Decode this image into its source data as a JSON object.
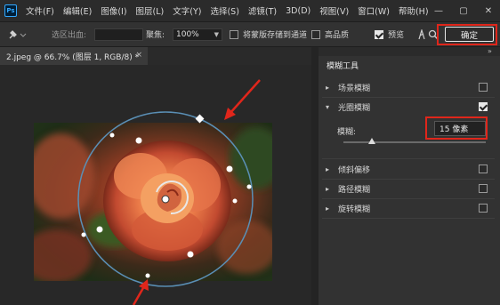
{
  "app": {
    "logo": "Ps"
  },
  "menu": [
    "文件(F)",
    "编辑(E)",
    "图像(I)",
    "图层(L)",
    "文字(Y)",
    "选择(S)",
    "滤镜(T)",
    "3D(D)",
    "视图(V)",
    "窗口(W)",
    "帮助(H)"
  ],
  "window_controls": {
    "minimize": "—",
    "restore": "▢",
    "close": "✕"
  },
  "options": {
    "pin_icon": "pin-icon",
    "selection_label": "选区出血:",
    "focus_label": "聚焦:",
    "focus_value": "100%",
    "save_mask_label": "将蒙版存储到通道",
    "save_mask_checked": false,
    "high_quality_label": "高品质",
    "high_quality_checked": false,
    "preview_label": "预览",
    "preview_checked": true,
    "ok_label": "确定"
  },
  "document": {
    "tab_title": "2.jpeg @ 66.7% (图层 1, RGB/8) *",
    "close": "×"
  },
  "panel": {
    "tab_label": "模糊工具",
    "collapse_icon": "»",
    "items": [
      {
        "label": "场景模糊",
        "expanded": false,
        "checked": false
      },
      {
        "label": "光圈模糊",
        "expanded": true,
        "checked": true
      },
      {
        "label": "倾斜偏移",
        "expanded": false,
        "checked": false
      },
      {
        "label": "路径模糊",
        "expanded": false,
        "checked": false
      },
      {
        "label": "旋转模糊",
        "expanded": false,
        "checked": false
      }
    ],
    "blur_label": "模糊:",
    "blur_value": "15 像素",
    "blur_slider_fraction": 0.2
  },
  "colors": {
    "highlight": "#e0261b",
    "accent": "#31a8ff"
  }
}
